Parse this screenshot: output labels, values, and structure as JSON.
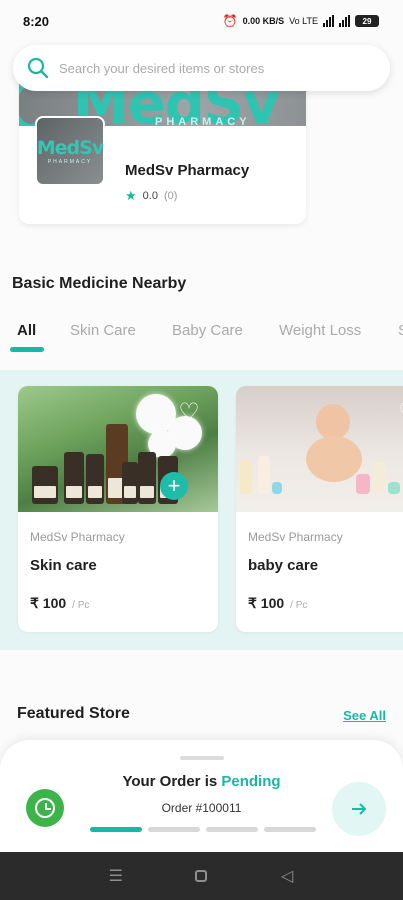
{
  "status_bar": {
    "time": "8:20",
    "net_speed": "0.00 KB/S",
    "network": "Vo LTE",
    "battery": "29",
    "alarm_icon": "alarm-icon",
    "signal_icon": "signal-icon"
  },
  "search": {
    "placeholder": "Search your desired items or stores",
    "icon": "search-icon"
  },
  "top_store": {
    "banner_brand": "MedSv",
    "banner_sub": "PHARMACY",
    "logo_text": "MedSv",
    "logo_sub": "PHARMACY",
    "name": "MedSv Pharmacy",
    "rating": "0.0",
    "rating_count": "(0)"
  },
  "nearby": {
    "title": "Basic Medicine Nearby",
    "tabs": [
      "All",
      "Skin Care",
      "Baby Care",
      "Weight Loss",
      "S"
    ],
    "active_tab": "All"
  },
  "products": [
    {
      "vendor": "MedSv Pharmacy",
      "name": "Skin care",
      "price": "₹ 100",
      "unit": "/ Pc"
    },
    {
      "vendor": "MedSv Pharmacy",
      "name": "baby care",
      "price": "₹ 100",
      "unit": "/ Pc"
    }
  ],
  "featured": {
    "title": "Featured Store",
    "see_all": "See All"
  },
  "order": {
    "status_prefix": "Your Order is",
    "status_value": "Pending",
    "order_no": "Order #100011",
    "progress_steps": 4,
    "progress_done": 1
  },
  "colors": {
    "accent": "#19b7a6",
    "clock_green": "#3cb44a",
    "band": "#e3f4f2"
  }
}
